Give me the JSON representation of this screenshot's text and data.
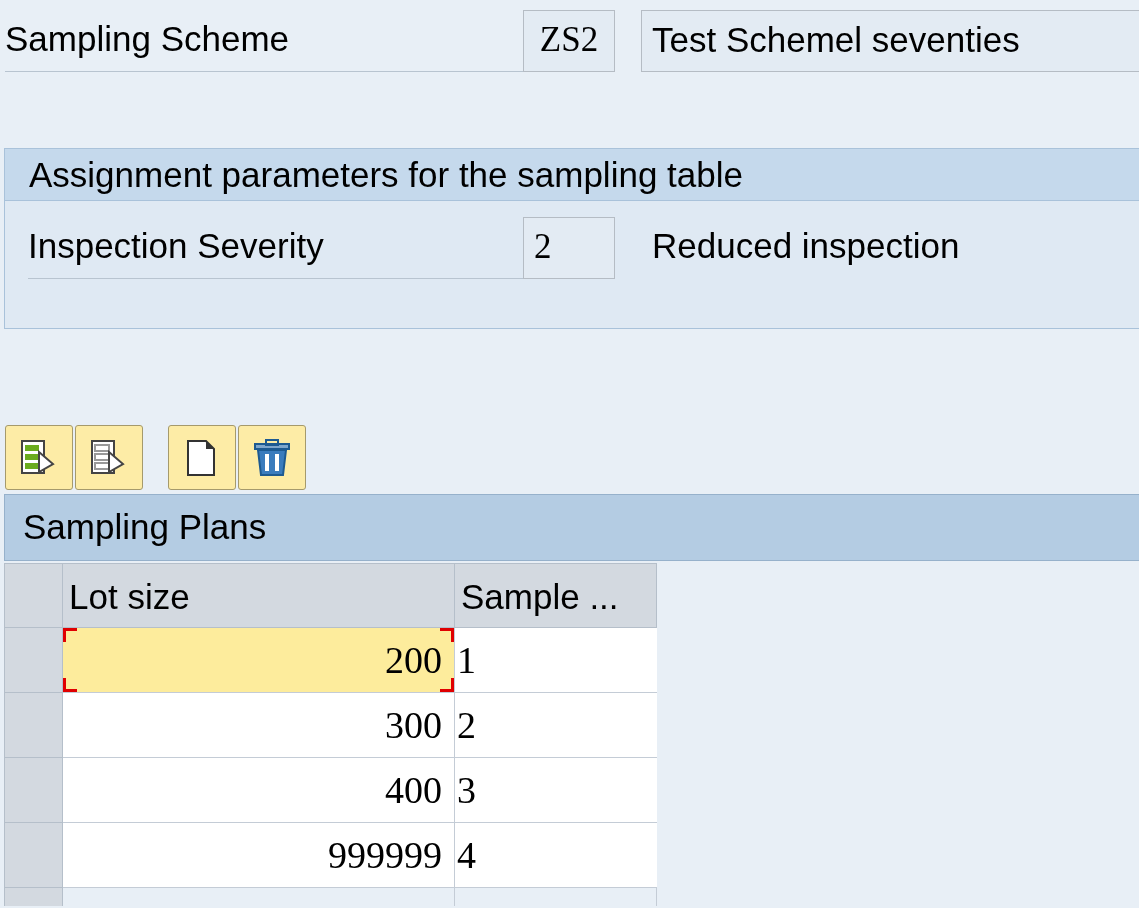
{
  "header": {
    "label": "Sampling Scheme",
    "code": "ZS2",
    "description": "Test Schemel seventies"
  },
  "group": {
    "title": "Assignment parameters for the sampling table",
    "label": "Inspection Severity",
    "code": "2",
    "description": "Reduced inspection"
  },
  "toolbar": [
    {
      "kind": "select-all"
    },
    {
      "kind": "deselect-all"
    },
    {
      "kind": "new"
    },
    {
      "kind": "delete"
    }
  ],
  "table": {
    "title": "Sampling Plans",
    "columns": [
      "Lot size",
      "Sample ..."
    ],
    "rows": [
      {
        "cells": [
          "200",
          "1"
        ],
        "selected": true
      },
      {
        "cells": [
          "300",
          "2"
        ],
        "selected": false
      },
      {
        "cells": [
          "400",
          "3"
        ],
        "selected": false
      },
      {
        "cells": [
          "999999",
          "4"
        ],
        "selected": false
      }
    ]
  }
}
